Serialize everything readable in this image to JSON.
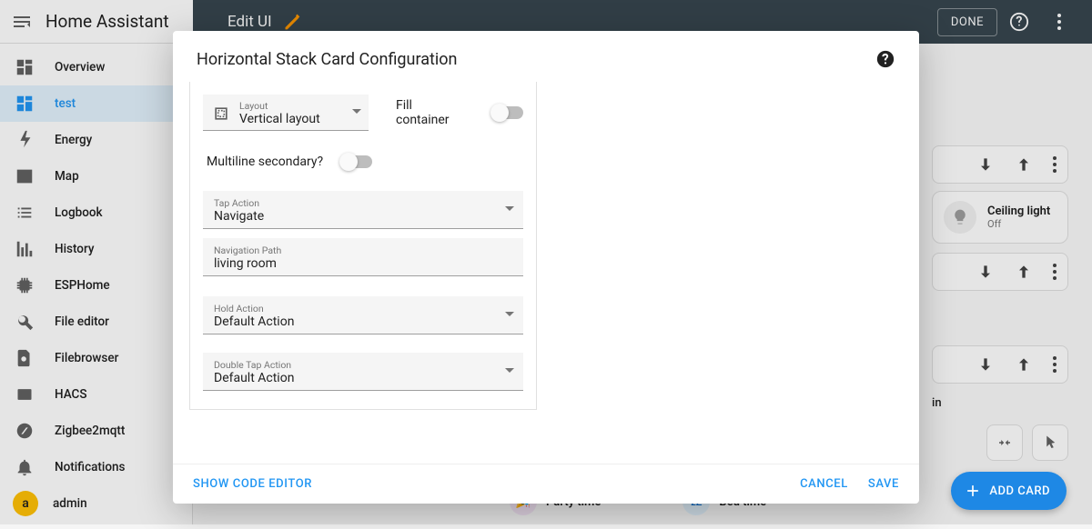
{
  "header": {
    "app_title": "Home Assistant",
    "edit_ui": "Edit UI",
    "done": "DONE"
  },
  "sidebar": {
    "items": [
      {
        "label": "Overview"
      },
      {
        "label": "test"
      },
      {
        "label": "Energy"
      },
      {
        "label": "Map"
      },
      {
        "label": "Logbook"
      },
      {
        "label": "History"
      },
      {
        "label": "ESPHome"
      },
      {
        "label": "File editor"
      },
      {
        "label": "Filebrowser"
      },
      {
        "label": "HACS"
      },
      {
        "label": "Zigbee2mqtt"
      }
    ],
    "notifications": "Notifications",
    "user": {
      "initial": "a",
      "name": "admin"
    }
  },
  "modal": {
    "title": "Horizontal Stack Card Configuration",
    "layout": {
      "label": "Layout",
      "value": "Vertical layout"
    },
    "fill_container": {
      "label": "Fill container",
      "on": false
    },
    "multiline": {
      "label": "Multiline secondary?",
      "on": false
    },
    "tap_action": {
      "label": "Tap Action",
      "value": "Navigate"
    },
    "nav_path": {
      "label": "Navigation Path",
      "value": "living room"
    },
    "hold_action": {
      "label": "Hold Action",
      "value": "Default Action"
    },
    "dbl_tap": {
      "label": "Double Tap Action",
      "value": "Default Action"
    },
    "show_code": "SHOW CODE EDITOR",
    "cancel": "CANCEL",
    "save": "SAVE"
  },
  "peek": {
    "entity": {
      "name": "Ceiling light",
      "state": "Off"
    },
    "text": "in",
    "scene1": "Party time",
    "scene2": "Bed time"
  },
  "fab": "ADD CARD"
}
